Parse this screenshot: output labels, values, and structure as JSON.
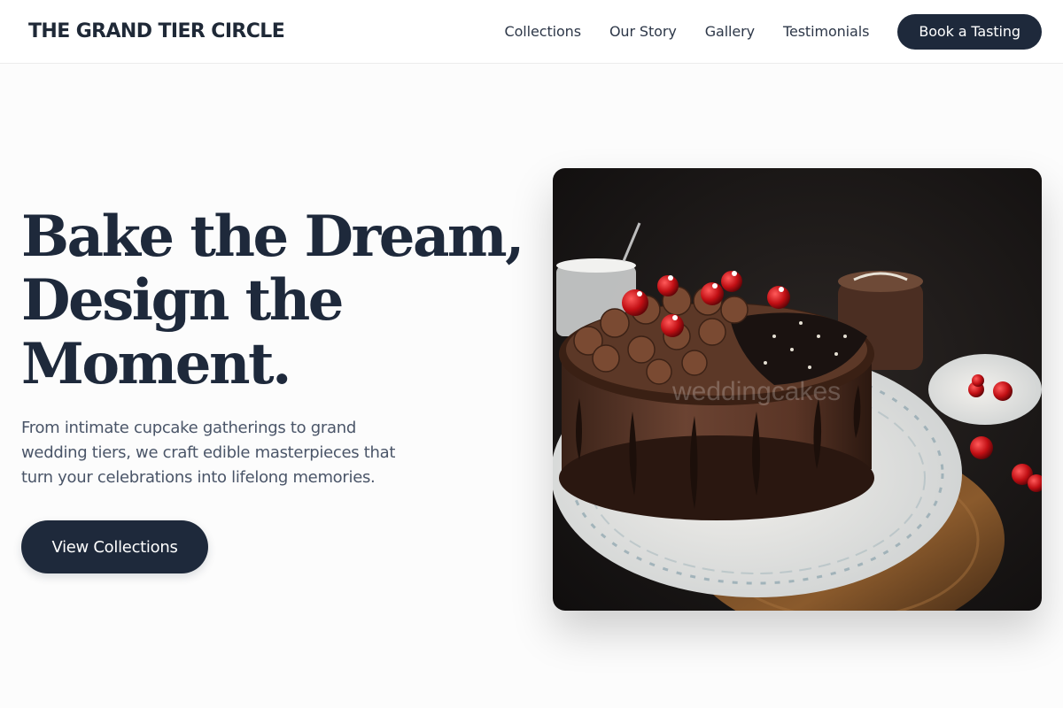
{
  "header": {
    "brand": "THE GRAND TIER CIRCLE",
    "nav": [
      "Collections",
      "Our Story",
      "Gallery",
      "Testimonials"
    ],
    "cta": "Book a Tasting"
  },
  "hero": {
    "headline_lines": [
      "Bake the Dream,",
      "Design the",
      "Moment."
    ],
    "subtext": "From intimate cupcake gatherings to grand wedding tiers, we craft edible masterpieces that turn your celebrations into lifelong memories.",
    "cta": "View Collections",
    "image": {
      "subject": "chocolate drip cake with cherries on a decorated plate",
      "watermark": "weddingcakes"
    }
  },
  "colors": {
    "primary": "#1e293b",
    "text": "#4a5568",
    "background": "#fcfcfc"
  }
}
